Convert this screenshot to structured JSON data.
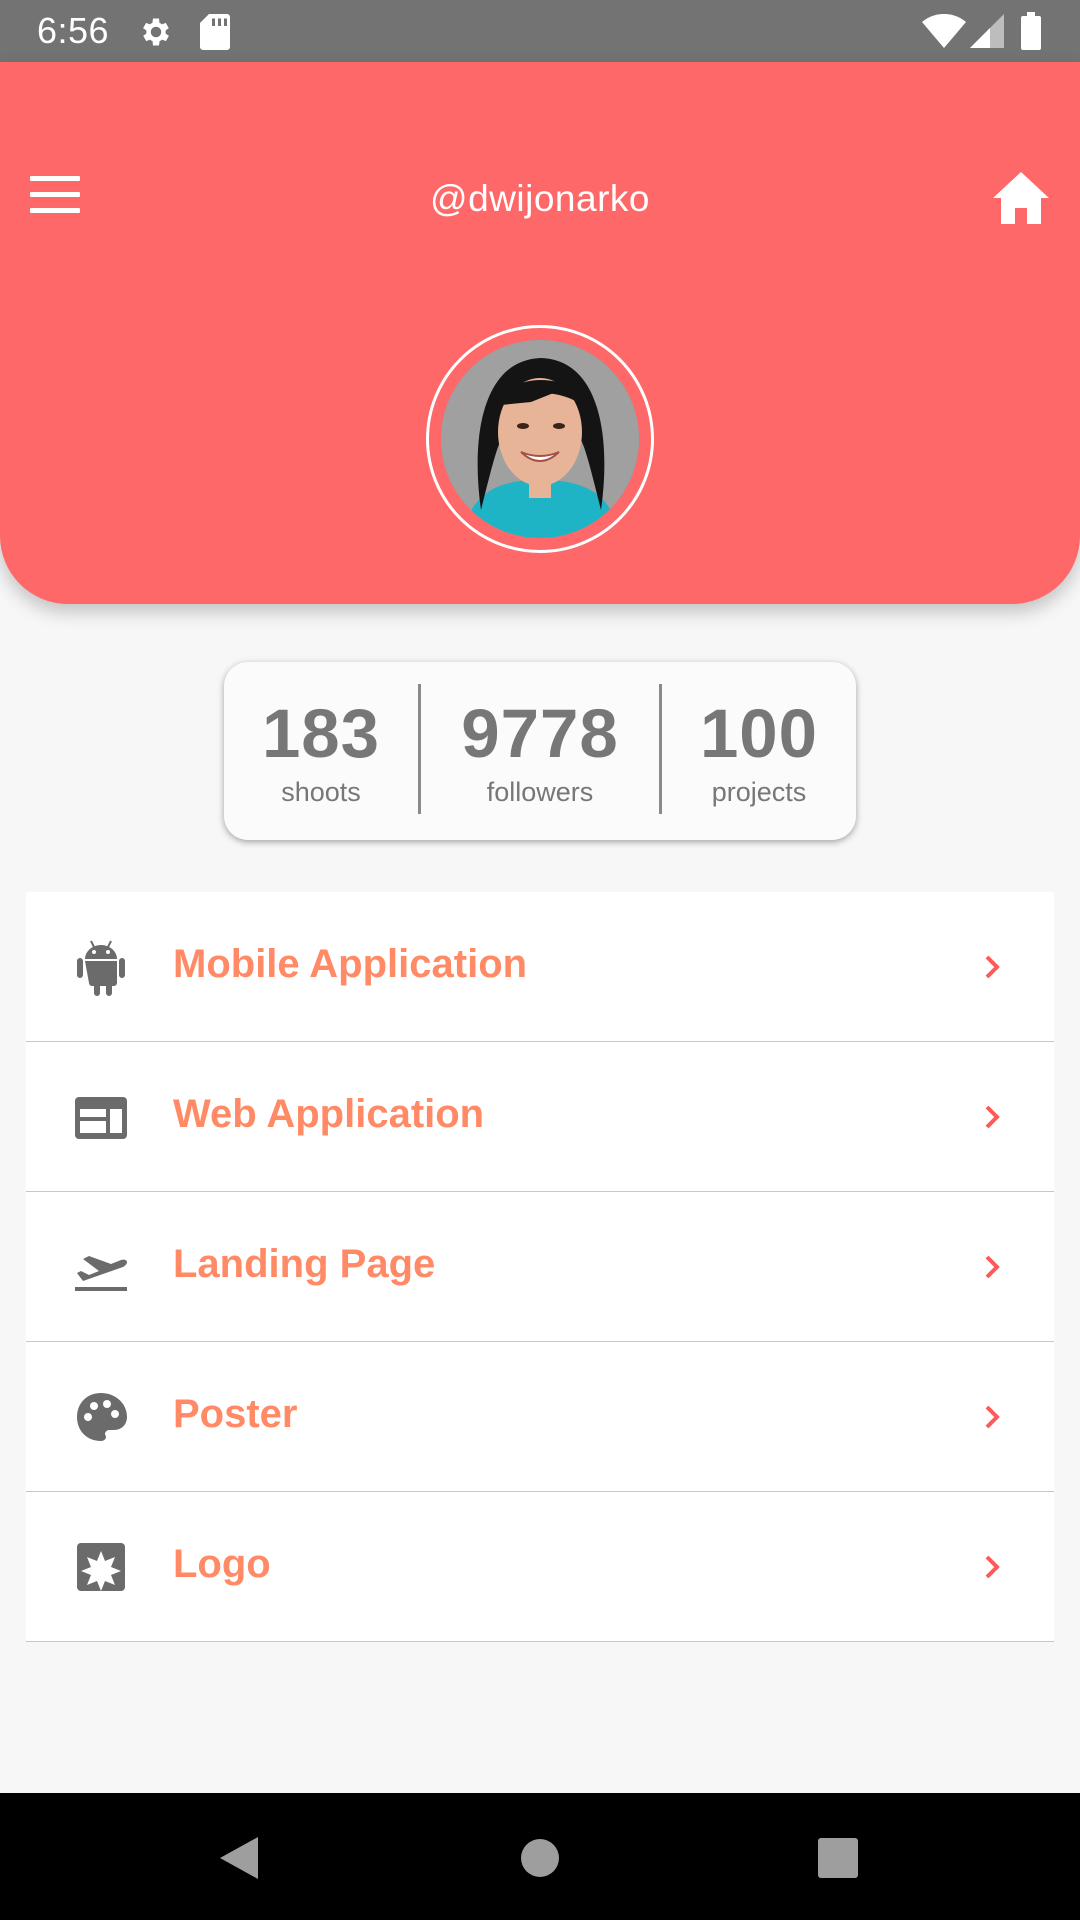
{
  "status_bar": {
    "time": "6:56",
    "icons": [
      "gear-icon",
      "sd-card-icon",
      "wifi-icon",
      "signal-icon",
      "battery-icon"
    ]
  },
  "header": {
    "username": "@dwijonarko",
    "menu_icon": "hamburger-menu-icon",
    "home_icon": "home-icon",
    "background_color": "#ff6868"
  },
  "stats": [
    {
      "value": "183",
      "label": "shoots"
    },
    {
      "value": "9778",
      "label": "followers"
    },
    {
      "value": "100",
      "label": "projects"
    }
  ],
  "menu": {
    "items": [
      {
        "label": "Mobile Application",
        "icon": "android-icon"
      },
      {
        "label": "Web Application",
        "icon": "web-window-icon"
      },
      {
        "label": "Landing Page",
        "icon": "flight-takeoff-icon"
      },
      {
        "label": "Poster",
        "icon": "palette-icon"
      },
      {
        "label": "Logo",
        "icon": "logo-icon"
      }
    ],
    "label_color": "#ff8a65",
    "chevron_color": "#ff5a5a"
  },
  "nav_bar": {
    "icons": [
      "back-icon",
      "home-circle-icon",
      "recents-icon"
    ]
  }
}
